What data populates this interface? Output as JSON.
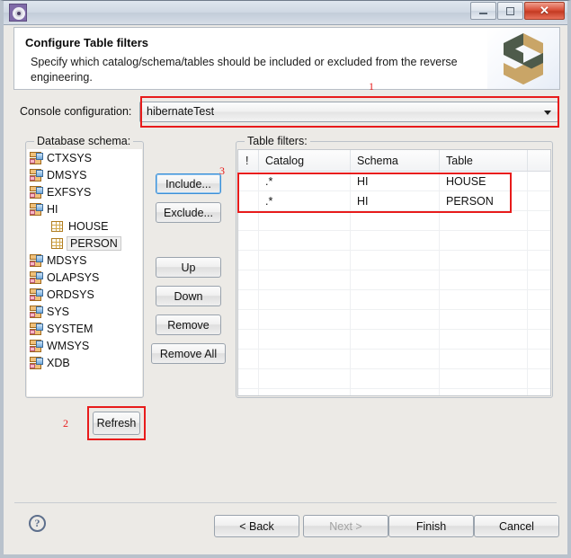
{
  "window": {
    "icon": "gear-icon",
    "buttons": {
      "minimize": "–",
      "maximize": "□",
      "close": "✕"
    }
  },
  "header": {
    "title": "Configure Table filters",
    "description": "Specify which catalog/schema/tables should be included or excluded from the reverse engineering.",
    "logo": "hibernate-logo"
  },
  "console": {
    "label": "Console configuration:",
    "value": "hibernateTest",
    "dropdown_icon": "chevron-down-icon"
  },
  "schema_group": {
    "legend": "Database schema:",
    "items": [
      {
        "label": "CTXSYS",
        "type": "schema",
        "selected": false
      },
      {
        "label": "DMSYS",
        "type": "schema",
        "selected": false
      },
      {
        "label": "EXFSYS",
        "type": "schema",
        "selected": false
      },
      {
        "label": "HI",
        "type": "schema",
        "selected": false
      },
      {
        "label": "HOUSE",
        "type": "table",
        "selected": false
      },
      {
        "label": "PERSON",
        "type": "table",
        "selected": true
      },
      {
        "label": "MDSYS",
        "type": "schema",
        "selected": false
      },
      {
        "label": "OLAPSYS",
        "type": "schema",
        "selected": false
      },
      {
        "label": "ORDSYS",
        "type": "schema",
        "selected": false
      },
      {
        "label": "SYS",
        "type": "schema",
        "selected": false
      },
      {
        "label": "SYSTEM",
        "type": "schema",
        "selected": false
      },
      {
        "label": "WMSYS",
        "type": "schema",
        "selected": false
      },
      {
        "label": "XDB",
        "type": "schema",
        "selected": false
      }
    ]
  },
  "action_buttons": {
    "include": "Include...",
    "exclude": "Exclude...",
    "up": "Up",
    "down": "Down",
    "remove": "Remove",
    "remove_all": "Remove All",
    "refresh": "Refresh"
  },
  "filters_group": {
    "legend": "Table filters:",
    "columns": [
      "!",
      "Catalog",
      "Schema",
      "Table",
      ""
    ],
    "rows": [
      {
        "flag": "",
        "catalog": ".*",
        "schema": "HI",
        "table": "HOUSE",
        "extra": ""
      },
      {
        "flag": "",
        "catalog": ".*",
        "schema": "HI",
        "table": "PERSON",
        "extra": ""
      }
    ],
    "empty_row_count": 10
  },
  "footer": {
    "help": "?",
    "back": "< Back",
    "next": "Next >",
    "next_disabled": true,
    "finish": "Finish",
    "cancel": "Cancel"
  },
  "annotations": {
    "one": "1",
    "two": "2",
    "three": "3"
  },
  "colors": {
    "annotation_red": "#e81b1b",
    "focus_blue": "#3c8fd6",
    "logo_gold": "#c9a567",
    "logo_green": "#4e5b4b",
    "title_close_red": "#c33a22"
  }
}
